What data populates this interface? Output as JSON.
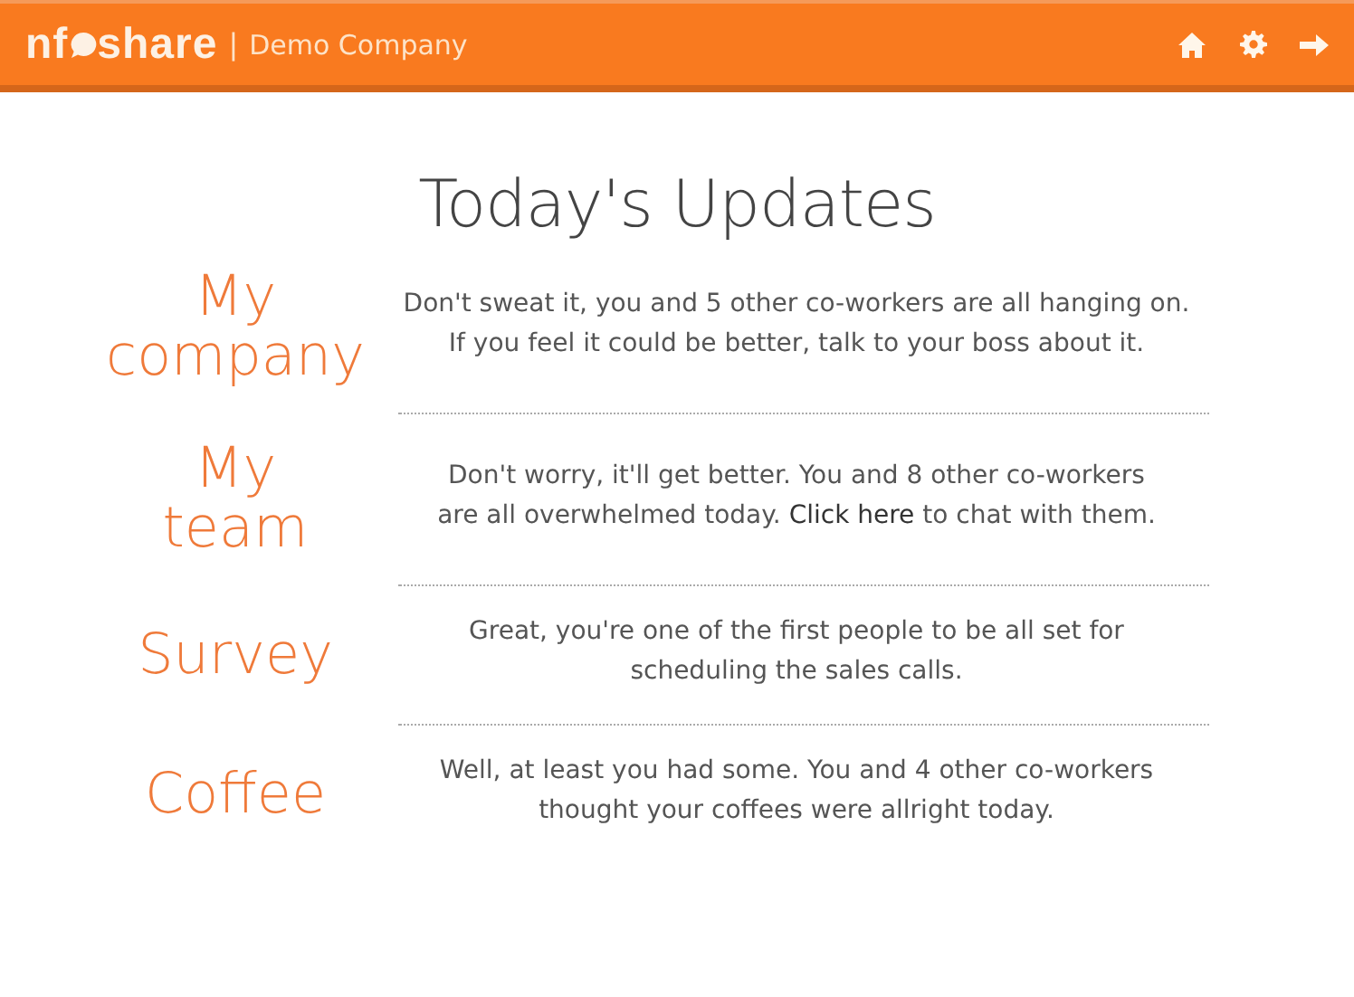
{
  "header": {
    "logo_start": "nf",
    "logo_end": "share",
    "separator": "|",
    "company": "Demo Company"
  },
  "title": "Today's Updates",
  "updates": [
    {
      "label_lines": [
        "My",
        "company"
      ],
      "message_lines": [
        [
          {
            "kind": "text",
            "text": "Don't sweat it, you and 5 other co-workers are all hanging on."
          }
        ],
        [
          {
            "kind": "text",
            "text": "If you feel it could be better, talk to your boss about it."
          }
        ]
      ]
    },
    {
      "label_lines": [
        "My",
        "team"
      ],
      "message_lines": [
        [
          {
            "kind": "text",
            "text": "Don't worry, it'll get better. You and 8 other co-workers"
          }
        ],
        [
          {
            "kind": "text",
            "text": "are all overwhelmed today. "
          },
          {
            "kind": "link",
            "text": "Click here"
          },
          {
            "kind": "text",
            "text": " to chat with them."
          }
        ]
      ]
    },
    {
      "label_lines": [
        "Survey"
      ],
      "message_lines": [
        [
          {
            "kind": "text",
            "text": "Great, you're one of the first people to be all set for"
          }
        ],
        [
          {
            "kind": "text",
            "text": "scheduling the sales calls."
          }
        ]
      ]
    },
    {
      "label_lines": [
        "Coffee"
      ],
      "message_lines": [
        [
          {
            "kind": "text",
            "text": "Well, at least you had some. You and 4 other co-workers"
          }
        ],
        [
          {
            "kind": "text",
            "text": "thought your coffees were allright today."
          }
        ]
      ]
    }
  ]
}
